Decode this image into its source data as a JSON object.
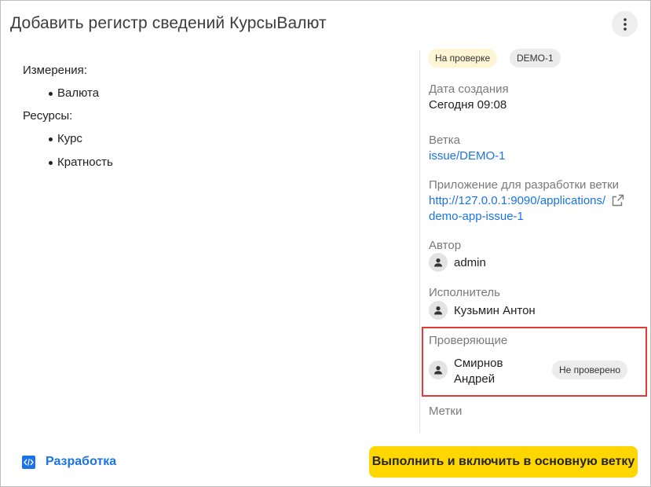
{
  "header": {
    "title": "Добавить регистр сведений КурсыВалют",
    "menu_icon": "more-vertical-icon"
  },
  "content": {
    "dimensions_heading": "Измерения:",
    "dimensions": [
      "Валюта"
    ],
    "resources_heading": "Ресурсы:",
    "resources": [
      "Курс",
      "Кратность"
    ]
  },
  "sidebar": {
    "status_chip": "На проверке",
    "issue_key": "DEMO-1",
    "created_label": "Дата создания",
    "created_value": "Сегодня 09:08",
    "branch_label": "Ветка",
    "branch_value": "issue/DEMO-1",
    "app_label": "Приложение для разработки ветки",
    "app_url_line1": "http://127.0.0.1:9090/applications/",
    "app_url_line2": "demo-app-issue-1",
    "author_label": "Автор",
    "author_name": "admin",
    "assignee_label": "Исполнитель",
    "assignee_name": "Кузьмин Антон",
    "reviewers_label": "Проверяющие",
    "reviewer_name_line1": "Смирнов",
    "reviewer_name_line2": "Андрей",
    "reviewer_status": "Не проверено",
    "tags_label": "Метки"
  },
  "footer": {
    "dev_link": "Разработка",
    "primary_button": "Выполнить и включить в основную ветку"
  },
  "colors": {
    "accent_link": "#1a73e8",
    "primary_button": "#ffd700",
    "status_chip_bg": "#fdf5d3",
    "highlight_border": "#e53935"
  }
}
